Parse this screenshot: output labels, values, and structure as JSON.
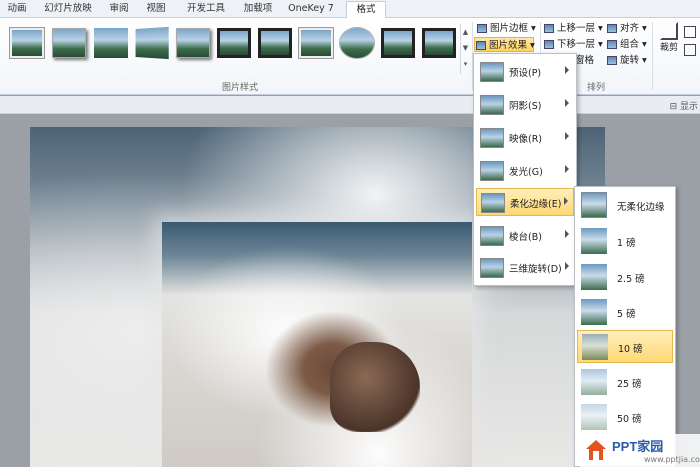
{
  "tabs": [
    "动画",
    "幻灯片放映",
    "审阅",
    "视图",
    "开发工具",
    "加载项",
    "OneKey 7",
    "格式"
  ],
  "active_tab": "格式",
  "ribbon": {
    "picture_styles_label": "图片样式",
    "arrange_label": "排列",
    "picture_border": "图片边框",
    "picture_effects": "图片效果",
    "bring_forward": "上移一层",
    "send_backward": "下移一层",
    "selection_pane_partial": "窗格",
    "align": "对齐",
    "group": "组合",
    "rotate": "旋转",
    "crop": "裁剪",
    "show_partial": "显示"
  },
  "effects_menu": [
    {
      "label": "预设(P)",
      "selected": false
    },
    {
      "label": "阴影(S)",
      "selected": false
    },
    {
      "label": "映像(R)",
      "selected": false
    },
    {
      "label": "发光(G)",
      "selected": false
    },
    {
      "label": "柔化边缘(E)",
      "selected": true
    },
    {
      "label": "棱台(B)",
      "selected": false
    },
    {
      "label": "三维旋转(D)",
      "selected": false
    }
  ],
  "soft_edges_menu": [
    {
      "label": "无柔化边缘",
      "selected": false
    },
    {
      "label": "1 磅",
      "selected": false
    },
    {
      "label": "2.5 磅",
      "selected": false
    },
    {
      "label": "5 磅",
      "selected": false
    },
    {
      "label": "10 磅",
      "selected": true
    },
    {
      "label": "25 磅",
      "selected": false
    },
    {
      "label": "50 磅",
      "selected": false
    }
  ],
  "watermark": {
    "brand": "PPT家园",
    "url": "www.pptjia.com"
  },
  "colors": {
    "highlight": "#ffd874",
    "ribbon_border": "#c5cfdb",
    "brand": "#2b5cab"
  }
}
